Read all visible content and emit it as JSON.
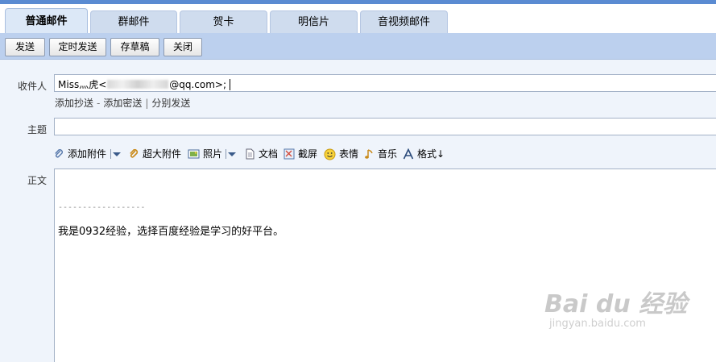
{
  "tabs": [
    {
      "label": "普通邮件",
      "active": true
    },
    {
      "label": "群邮件",
      "active": false
    },
    {
      "label": "贺卡",
      "active": false
    },
    {
      "label": "明信片",
      "active": false
    },
    {
      "label": "音视频邮件",
      "active": false
    }
  ],
  "toolbar": {
    "send": "发送",
    "schedule_send": "定时发送",
    "save_draft": "存草稿",
    "close": "关闭"
  },
  "recipient": {
    "label": "收件人",
    "name": "Miss灬虎<",
    "email_suffix": "@qq.com>;"
  },
  "recipient_links": {
    "add_cc": "添加抄送",
    "separator": "-",
    "add_bcc": "添加密送",
    "bar": "|",
    "separate_send": "分别发送"
  },
  "subject": {
    "label": "主题",
    "value": ""
  },
  "attachments_toolbar": {
    "add_attachment": "添加附件",
    "large_attachment": "超大附件",
    "photo": "照片",
    "document": "文档",
    "screenshot": "截屏",
    "emoji": "表情",
    "music": "音乐",
    "format": "格式↓"
  },
  "body": {
    "label": "正文",
    "signature_line": "------------------",
    "text": "我是0932经验，选择百度经验是学习的好平台。"
  },
  "watermark": {
    "logo": "Bai du 经验",
    "url": "jingyan.baidu.com"
  },
  "colors": {
    "accent": "#5a8bd2",
    "toolbar_bg": "#bcd0ee",
    "tab_bg": "#cfdcee",
    "page_bg": "#eff4fb"
  }
}
